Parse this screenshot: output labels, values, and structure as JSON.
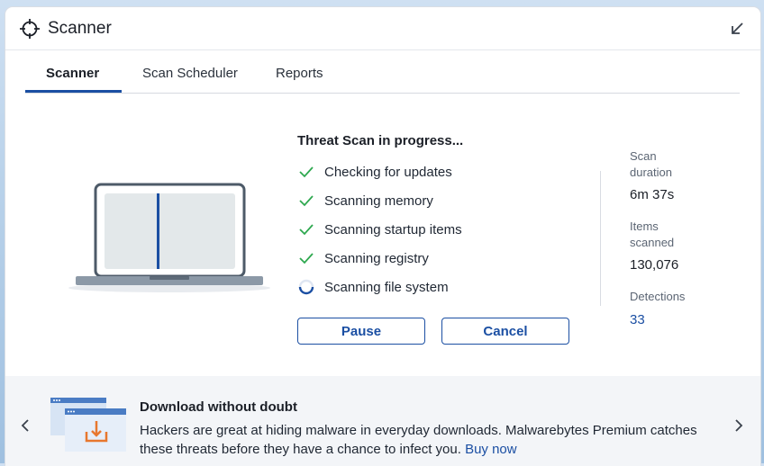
{
  "window": {
    "title": "Scanner"
  },
  "tabs": [
    {
      "label": "Scanner",
      "active": true
    },
    {
      "label": "Scan Scheduler",
      "active": false
    },
    {
      "label": "Reports",
      "active": false
    }
  ],
  "scan": {
    "heading": "Threat Scan in progress...",
    "steps": [
      {
        "label": "Checking for updates",
        "status": "done"
      },
      {
        "label": "Scanning memory",
        "status": "done"
      },
      {
        "label": "Scanning startup items",
        "status": "done"
      },
      {
        "label": "Scanning registry",
        "status": "done"
      },
      {
        "label": "Scanning file system",
        "status": "in-progress"
      }
    ],
    "pause_label": "Pause",
    "cancel_label": "Cancel"
  },
  "stats": {
    "duration_label_line1": "Scan",
    "duration_label_line2": "duration",
    "duration_value": "6m 37s",
    "items_label_line1": "Items",
    "items_label_line2": "scanned",
    "items_value": "130,076",
    "detections_label": "Detections",
    "detections_value": "33"
  },
  "promo": {
    "title": "Download without doubt",
    "body": "Hackers are great at hiding malware in everyday downloads. Malwarebytes Premium catches these threats before they have a chance to infect you.",
    "link_label": "Buy now"
  },
  "colors": {
    "accent": "#1b4fa3",
    "check": "#2ea84f",
    "promo_orange": "#e8772e"
  },
  "icons": {
    "title": "crosshair-icon",
    "shrink": "arrow-down-left-icon",
    "check": "check-icon",
    "progress": "spinner-icon",
    "prev": "chevron-left-icon",
    "next": "chevron-right-icon"
  }
}
